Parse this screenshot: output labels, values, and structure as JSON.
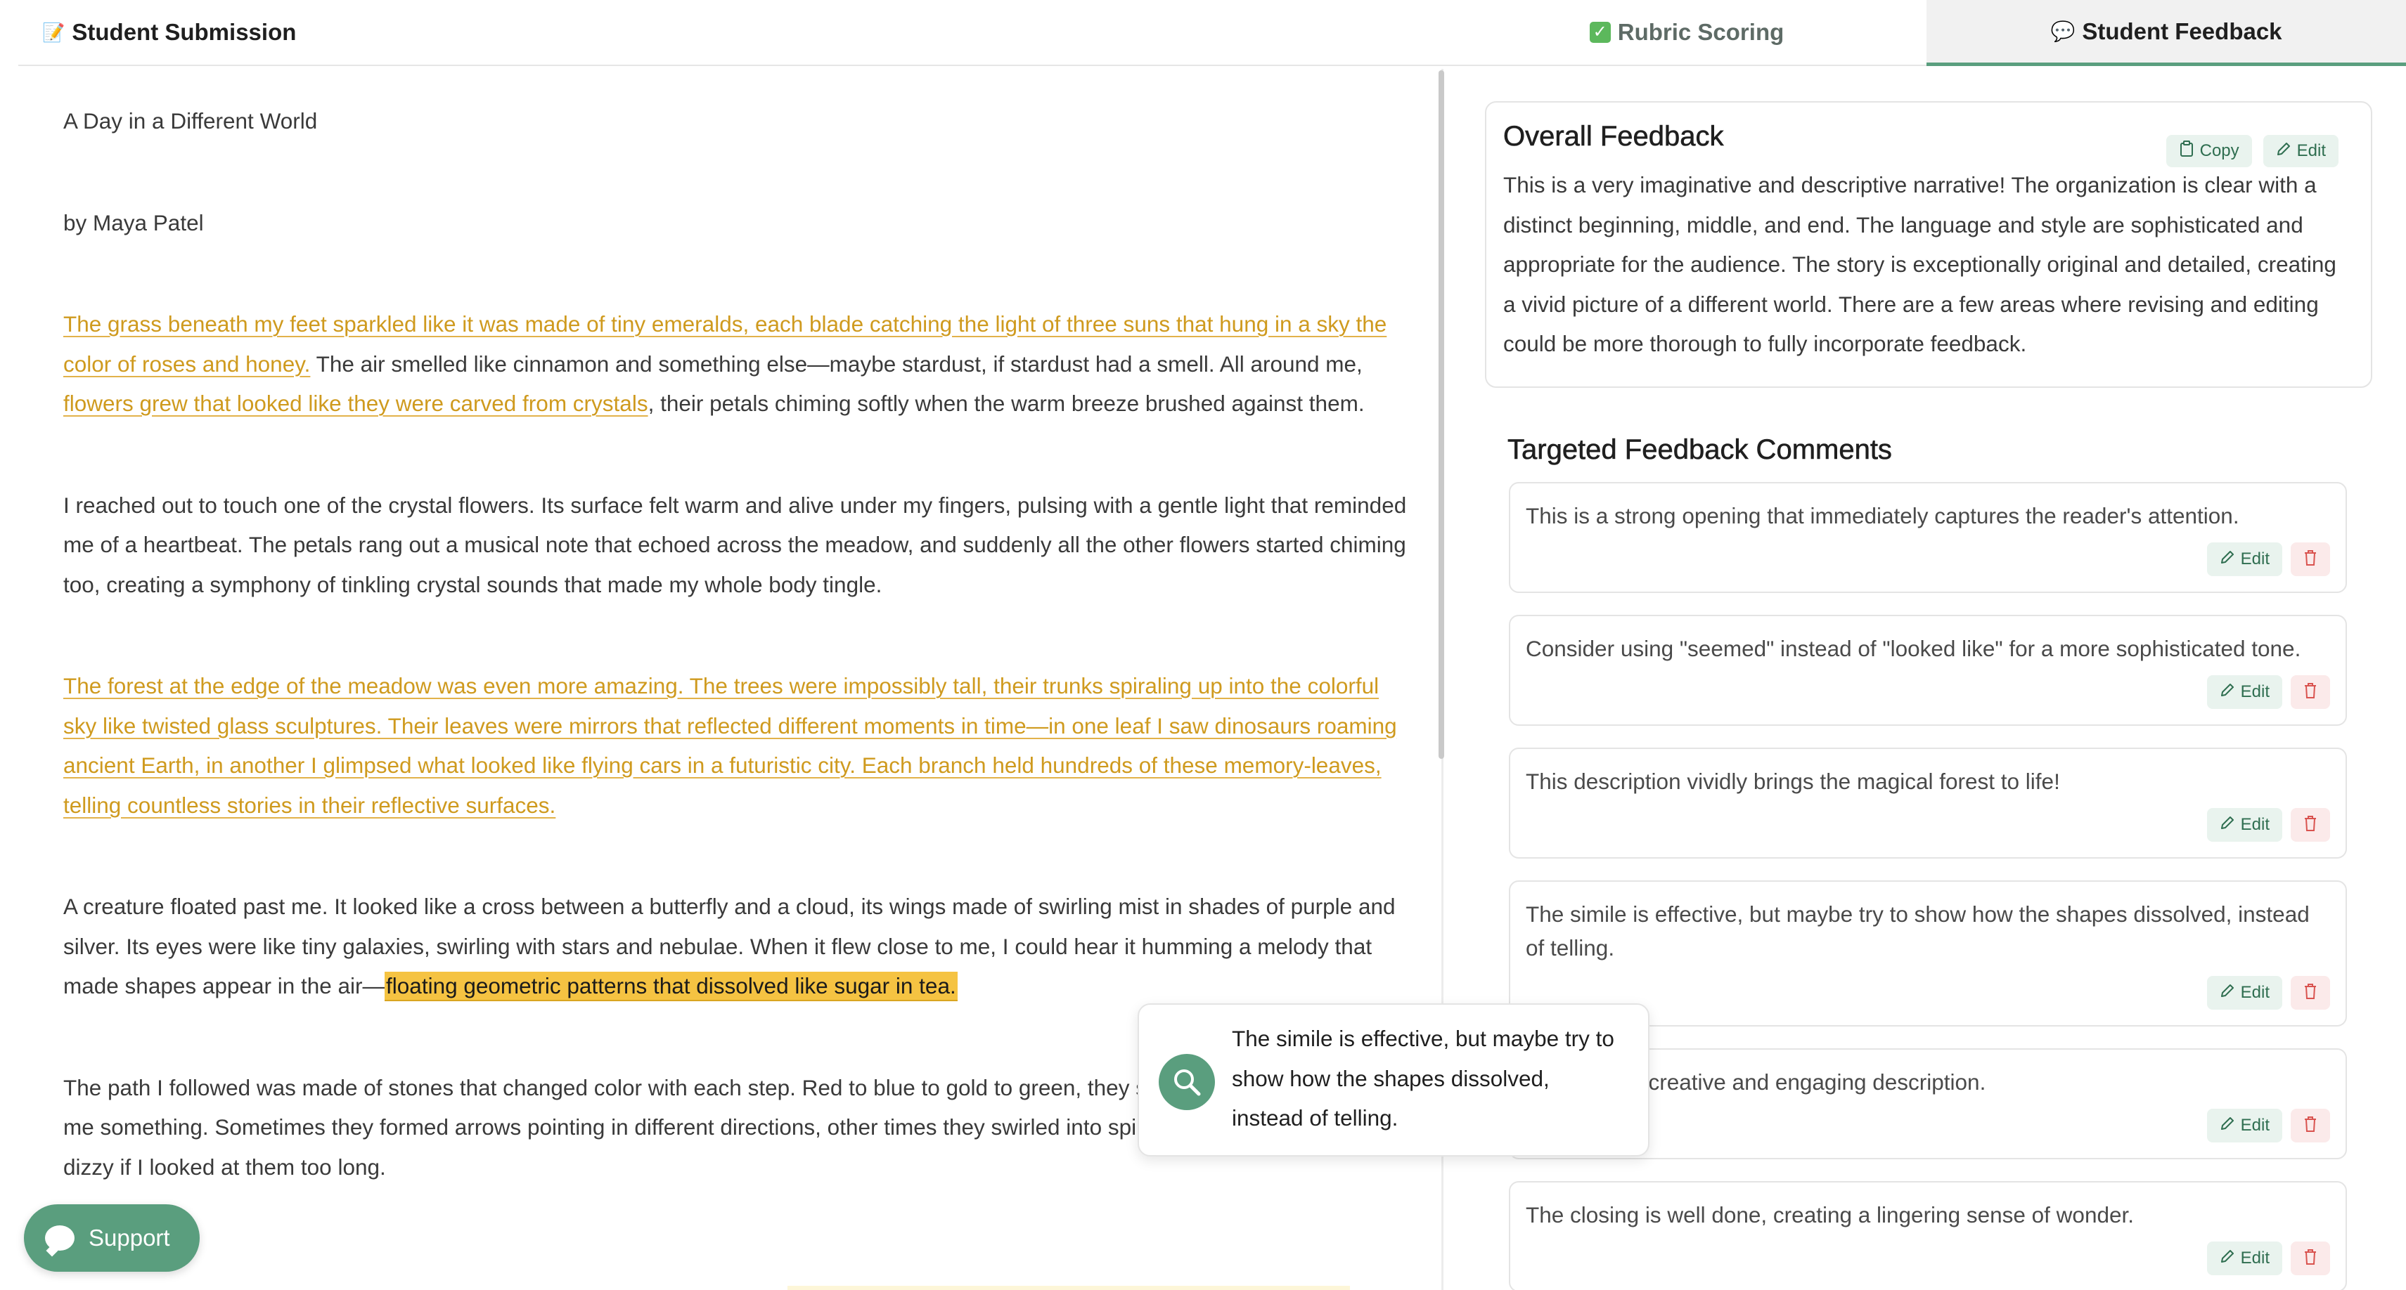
{
  "header": {
    "title_icon": "memo-icon",
    "title": "Student Submission"
  },
  "tabs": [
    {
      "label": "Rubric Scoring",
      "icon": "check-box-icon",
      "active": false
    },
    {
      "label": "Student Feedback",
      "icon": "speech-bubble-icon",
      "active": true
    }
  ],
  "essay": {
    "title": "A Day in a Different World",
    "byline": "by Maya Patel",
    "p1": {
      "h1": "The grass beneath my feet sparkled like it was made of tiny emeralds, each blade catching the light of three suns that hung in a sky the color of roses and honey.",
      "t1": " The air smelled like cinnamon and something else—maybe stardust, if stardust had a smell. All around me, ",
      "h2": "flowers grew that looked like they were carved from crystals",
      "t2": ", their petals chiming softly when the warm breeze brushed against them."
    },
    "p2": "I reached out to touch one of the crystal flowers. Its surface felt warm and alive under my fingers, pulsing with a gentle light that reminded me of a heartbeat. The petals rang out a musical note that echoed across the meadow, and suddenly all the other flowers started chiming too, creating a symphony of tinkling crystal sounds that made my whole body tingle.",
    "p3": "The forest at the edge of the meadow was even more amazing. The trees were impossibly tall, their trunks spiraling up into the colorful sky like twisted glass sculptures. Their leaves were mirrors that reflected different moments in time—in one leaf I saw dinosaurs roaming ancient Earth, in another I glimpsed what looked like flying cars in a futuristic city. Each branch held hundreds of these memory-leaves, telling countless stories in their reflective surfaces.",
    "p4": {
      "t1": "A creature floated past me. It looked like a cross between a butterfly and a cloud, its wings made of swirling mist in shades of purple and silver. Its eyes were like tiny galaxies, swirling with stars and nebulae. When it flew close to me, I could hear it humming a melody that made shapes appear in the air—",
      "h1": "floating geometric patterns that dissolved like sugar in tea."
    },
    "p5": "The path I followed was made of stones that changed color with each step. Red to blue to gold to green, they seemed to be trying to tell me something. Sometimes they formed arrows pointing in different directions, other times they swirled into spiral patterns that made me dizzy if I looked at them too long."
  },
  "overall": {
    "title": "Overall Feedback",
    "copy_label": "Copy",
    "edit_label": "Edit",
    "text": "This is a very imaginative and descriptive narrative! The organization is clear with a distinct beginning, middle, and end. The language and style are sophisticated and appropriate for the audience. The story is exceptionally original and detailed, creating a vivid picture of a different world. There are a few areas where revising and editing could be more thorough to fully incorporate feedback."
  },
  "targeted": {
    "title": "Targeted Feedback Comments",
    "edit_label": "Edit",
    "comments": [
      "This is a strong opening that immediately captures the reader's attention.",
      "Consider using \"seemed\" instead of \"looked like\" for a more sophisticated tone.",
      "This description vividly brings the magical forest to life!",
      "The simile is effective, but maybe try to show how the shapes dissolved, instead of telling.",
      "y creative and engaging description.",
      "The closing is well done, creating a lingering sense of wonder."
    ]
  },
  "popup": {
    "icon": "search-icon",
    "text": "The simile is effective, but maybe try to show how the shapes dissolved, instead of telling."
  },
  "support": {
    "label": "Support"
  },
  "colors": {
    "accent": "#5a9e7e",
    "highlight": "#f5c342",
    "underline_text": "#cf9a1e"
  }
}
